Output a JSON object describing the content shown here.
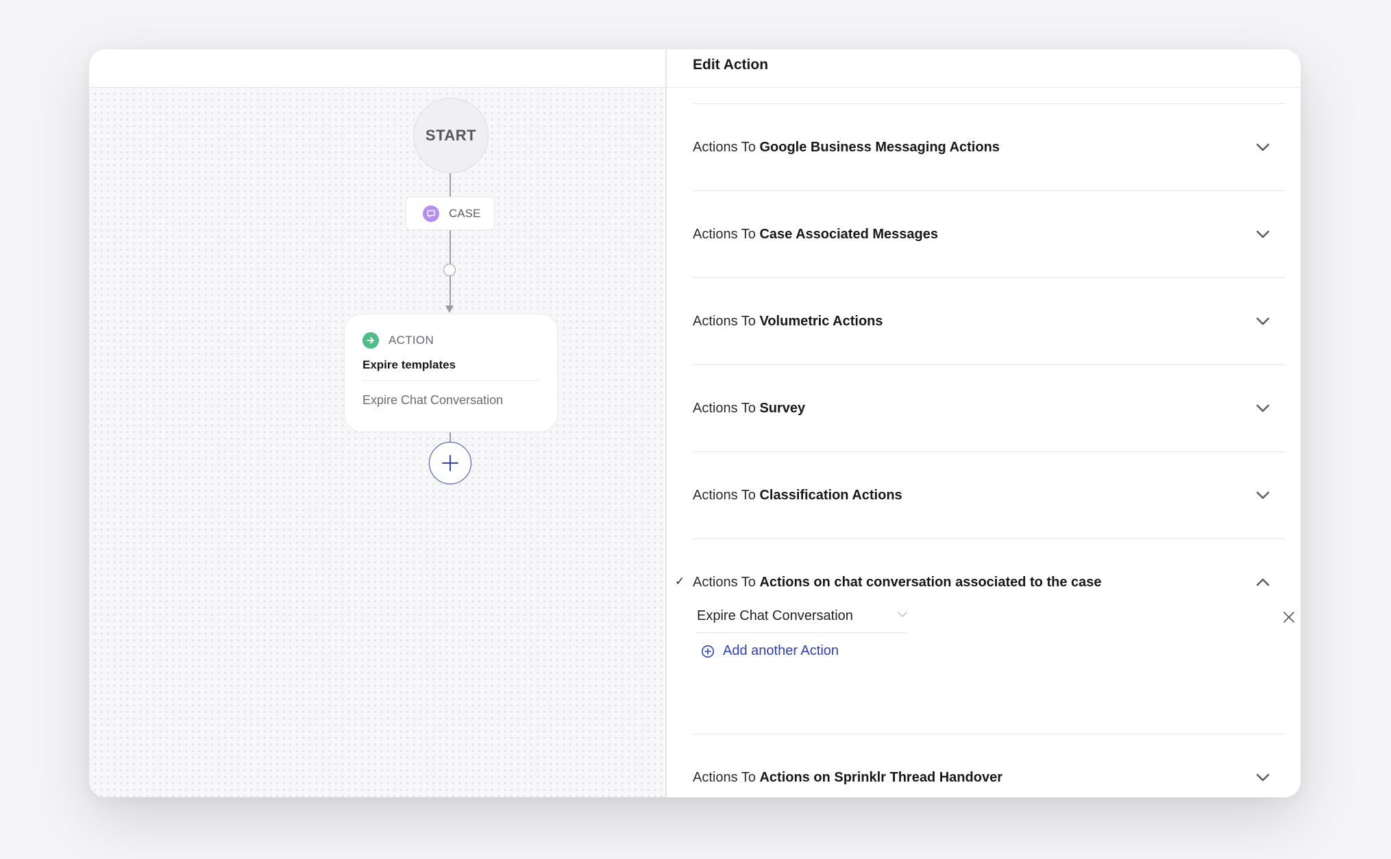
{
  "canvas": {
    "start_label": "START",
    "trigger": {
      "label": "CASE",
      "icon": "chat-bubble-icon",
      "color": "#b48ef2"
    },
    "action_card": {
      "type_label": "ACTION",
      "icon": "arrow-right-circle-icon",
      "icon_color": "#4fbd8a",
      "title": "Expire templates",
      "subtitle": "Expire Chat Conversation"
    },
    "add_node_icon": "plus-icon",
    "accent_color": "#2f43c8"
  },
  "panel": {
    "title": "Edit Action",
    "close_icon": "close-icon",
    "sections": [
      {
        "prefix": "Actions To ",
        "name": "Google Business Messaging Actions",
        "expanded": false,
        "selected": false
      },
      {
        "prefix": "Actions To ",
        "name": "Case Associated Messages",
        "expanded": false,
        "selected": false
      },
      {
        "prefix": "Actions To ",
        "name": "Volumetric Actions",
        "expanded": false,
        "selected": false
      },
      {
        "prefix": "Actions To ",
        "name": "Survey",
        "expanded": false,
        "selected": false
      },
      {
        "prefix": "Actions To ",
        "name": "Classification Actions",
        "expanded": false,
        "selected": false
      },
      {
        "prefix": "Actions To ",
        "name": "Actions on chat conversation associated to the case",
        "expanded": true,
        "selected": true,
        "check_mark": "✓"
      },
      {
        "prefix": "Actions To ",
        "name": "Actions on Sprinklr Thread Handover",
        "expanded": false,
        "selected": false
      }
    ],
    "expanded_section": {
      "selected_action": "Expire Chat Conversation",
      "add_link_label": "Add another Action",
      "link_color": "#2a3fc6"
    }
  }
}
